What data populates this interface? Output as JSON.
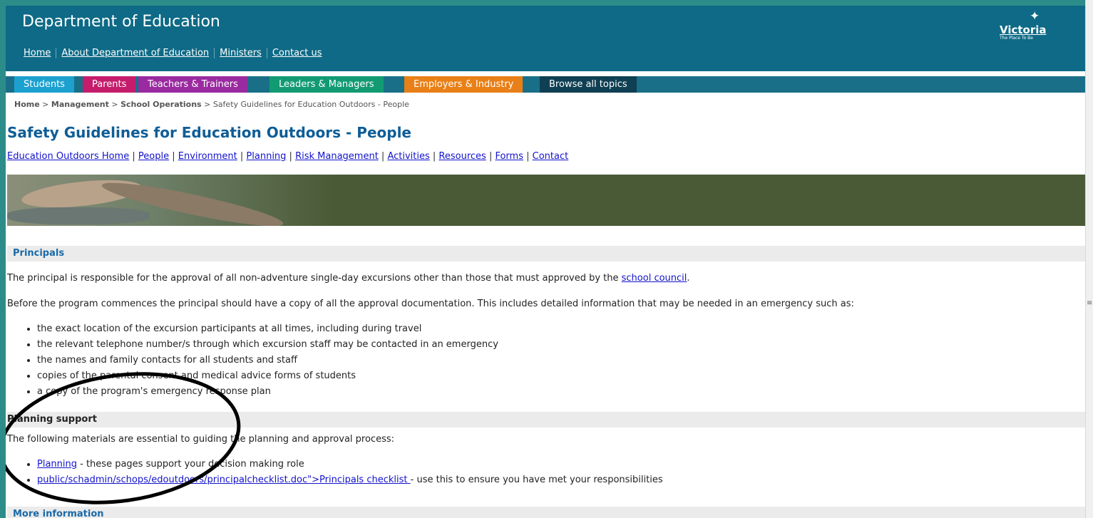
{
  "header": {
    "title": "Department of Education",
    "nav": [
      "Home",
      "About Department of Education",
      "Ministers",
      "Contact us"
    ],
    "logo": {
      "word": "Victoria",
      "tagline": "The Place To Be"
    }
  },
  "tabs": {
    "students": "Students",
    "parents": "Parents",
    "teachers": "Teachers & Trainers",
    "leaders": "Leaders & Managers",
    "employers": "Employers & Industry",
    "browse": "Browse all topics"
  },
  "breadcrumb": {
    "home": "Home",
    "management": "Management",
    "ops": "School Operations",
    "current": "Safety Guidelines for Education Outdoors - People",
    "sep": " > "
  },
  "page_title": "Safety Guidelines for Education Outdoors - People",
  "sub_nav": [
    "Education Outdoors Home",
    "People",
    "Environment",
    "Planning",
    "Risk Management",
    "Activities",
    "Resources",
    "Forms",
    "Contact"
  ],
  "principals": {
    "heading": "Principals",
    "p1_text": "The principal is responsible for the approval of all non-adventure single-day excursions other than those that must approved by the ",
    "p1_link": "school council",
    "p1_end": ".",
    "p2": "Before the program commences the principal should have a copy of all the approval documentation. This includes detailed information that may be needed in an emergency such as:",
    "bullets": [
      "the exact location of the excursion participants at all times, including during travel",
      "the relevant telephone number/s through which excursion staff may be contacted in an emergency",
      "the names and family contacts for all students and staff",
      "copies of the parental consent and medical advice forms of students",
      "a copy of the program's emergency response plan"
    ]
  },
  "planning_support": {
    "heading": "Planning support",
    "intro": "The following materials are essential to guiding the planning and approval process:",
    "items": [
      {
        "link": "Planning",
        "text": " - these pages support your decision making role"
      },
      {
        "link": "public/schadmin/schops/edoutdoors/principalchecklist.doc\">Principals checklist ",
        "text": " - use this to ensure you have met your responsibilities"
      }
    ]
  },
  "more_info": {
    "heading": "More information"
  },
  "colors": {
    "header_bg": "#0e6a86",
    "students": "#1ca0d0",
    "parents": "#c51d6c",
    "teachers": "#9a2aa0",
    "leaders": "#129b73",
    "employers": "#e97f17",
    "browse": "#0f3f52",
    "title": "#0e5d96",
    "link": "#1212cc"
  }
}
